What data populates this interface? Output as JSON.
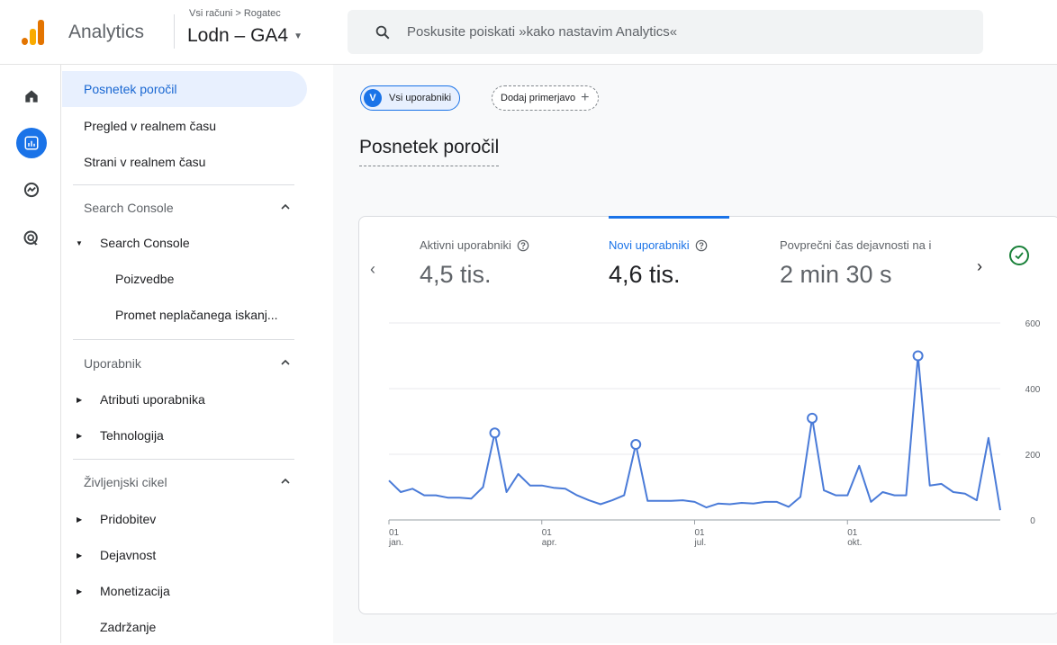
{
  "app": {
    "title": "Analytics",
    "breadcrumb": "Vsi računi > Rogatec",
    "property": "Lodn – GA4"
  },
  "search": {
    "placeholder": "Poskusite poiskati »kako nastavim Analytics«"
  },
  "rail": {
    "icons": [
      "home-icon",
      "reports-icon",
      "explore-icon",
      "advertising-icon"
    ],
    "active": "reports-icon"
  },
  "sidebar": {
    "items": [
      {
        "label": "Posnetek poročil",
        "active": true
      },
      {
        "label": "Pregled v realnem času"
      },
      {
        "label": "Strani v realnem času"
      }
    ],
    "sections": [
      {
        "title": "Search Console",
        "groups": [
          {
            "label": "Search Console",
            "expanded": true,
            "children": [
              "Poizvedbe",
              "Promet neplačanega iskanj..."
            ]
          }
        ]
      },
      {
        "title": "Uporabnik",
        "groups": [
          {
            "label": "Atributi uporabnika"
          },
          {
            "label": "Tehnologija"
          }
        ]
      },
      {
        "title": "Življenjski cikel",
        "groups": [
          {
            "label": "Pridobitev"
          },
          {
            "label": "Dejavnost"
          },
          {
            "label": "Monetizacija"
          },
          {
            "label": "Zadržanje",
            "noArrow": true
          }
        ]
      }
    ]
  },
  "main": {
    "chip_all": {
      "badge": "V",
      "label": "Vsi uporabniki"
    },
    "chip_add": {
      "label": "Dodaj primerjavo",
      "plus": "+"
    },
    "title": "Posnetek poročil",
    "metrics": [
      {
        "label": "Aktivni uporabniki",
        "value": "4,5 tis.",
        "active": false
      },
      {
        "label": "Novi uporabniki",
        "value": "4,6 tis.",
        "active": true
      },
      {
        "label": "Povprečni čas dejavnosti na i",
        "value": "2 min 30 s",
        "active": false
      }
    ]
  },
  "colors": {
    "accent": "#1a73e8",
    "line": "#4a7bd8",
    "success": "#188038"
  },
  "chart_data": {
    "type": "line",
    "series": [
      {
        "values": [
          120,
          85,
          95,
          75,
          75,
          68,
          68,
          65,
          100,
          265,
          85,
          140,
          105,
          105,
          98,
          95,
          75,
          60,
          48,
          60,
          75,
          230,
          58,
          58,
          58,
          60,
          55,
          38,
          50,
          48,
          52,
          50,
          55,
          55,
          40,
          70,
          310,
          90,
          75,
          75,
          165,
          55,
          85,
          75,
          75,
          500,
          105,
          110,
          85,
          80,
          60,
          250,
          30
        ]
      }
    ],
    "markers": [
      9,
      21,
      36,
      45
    ],
    "xticks": [
      {
        "index": 0,
        "day": "01",
        "month": "jan."
      },
      {
        "index": 13,
        "day": "01",
        "month": "apr."
      },
      {
        "index": 26,
        "day": "01",
        "month": "jul."
      },
      {
        "index": 39,
        "day": "01",
        "month": "okt."
      }
    ],
    "yticks": [
      0,
      200,
      400,
      600
    ],
    "ylim": [
      0,
      600
    ],
    "grid": true
  }
}
